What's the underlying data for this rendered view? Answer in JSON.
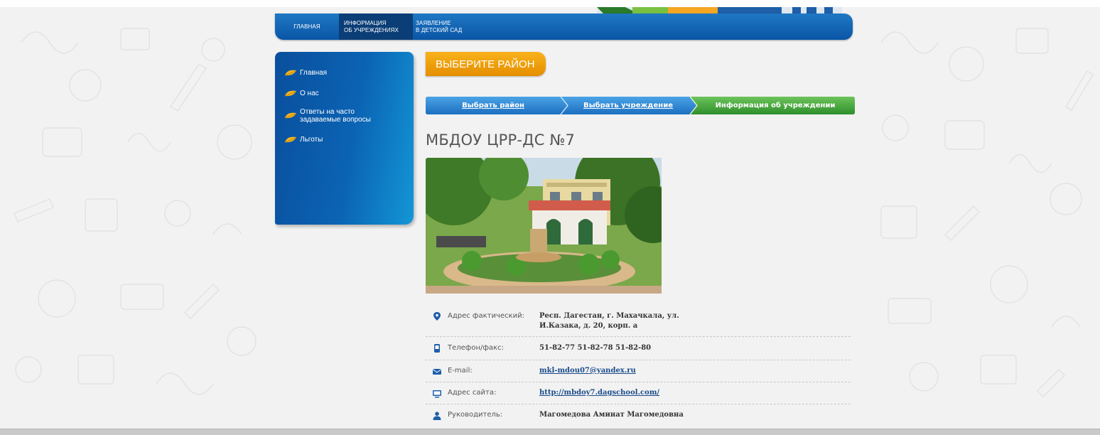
{
  "nav": {
    "items": [
      {
        "line1": "ГЛАВНАЯ",
        "line2": ""
      },
      {
        "line1": "ИНФОРМАЦИЯ",
        "line2": "ОБ УЧРЕЖДЕНИЯХ"
      },
      {
        "line1": "ЗАЯВЛЕНИЕ",
        "line2": "В ДЕТСКИЙ САД"
      }
    ],
    "active_index": 1
  },
  "sidebar": {
    "items": [
      {
        "label": "Главная",
        "icon": "leaf-icon"
      },
      {
        "label": "О нас",
        "icon": "leaf-icon"
      },
      {
        "label": "Ответы на часто задаваемые вопросы",
        "icon": "leaf-icon"
      },
      {
        "label": "Льготы",
        "icon": "leaf-icon"
      }
    ]
  },
  "district_button": "ВЫБЕРИТЕ РАЙОН",
  "steps": [
    {
      "label": "Выбрать район",
      "link": true
    },
    {
      "label": "Выбрать учреждение",
      "link": true
    },
    {
      "label": "Информация об учреждении",
      "link": false
    }
  ],
  "title": "МБДОУ ЦРР-ДС №7",
  "details": [
    {
      "icon": "location-pin-icon",
      "label": "Адрес фактический:",
      "value": "Респ. Дагестан, г. Махачкала, ул.",
      "value2": "И.Казака, д. 20, корп. а",
      "link": false
    },
    {
      "icon": "phone-icon",
      "label": "Телефон/факс:",
      "value": "51-82-77 51-82-78 51-82-80",
      "link": false
    },
    {
      "icon": "envelope-icon",
      "label": "E-mail:",
      "value": "mkl-mdou07@yandex.ru",
      "link": true
    },
    {
      "icon": "monitor-icon",
      "label": "Адрес сайта:",
      "value": "http://mbdoy7.dagschool.com/",
      "link": true
    },
    {
      "icon": "person-icon",
      "label": "Руководитель:",
      "value": "Магомедова Аминат Магомедовна",
      "link": false
    }
  ],
  "colors": {
    "nav_blue": "#0a55a6",
    "nav_active": "#0b3e77",
    "orange": "#f0a010",
    "step_blue": "#2b86cf",
    "step_green": "#3ea53b"
  }
}
